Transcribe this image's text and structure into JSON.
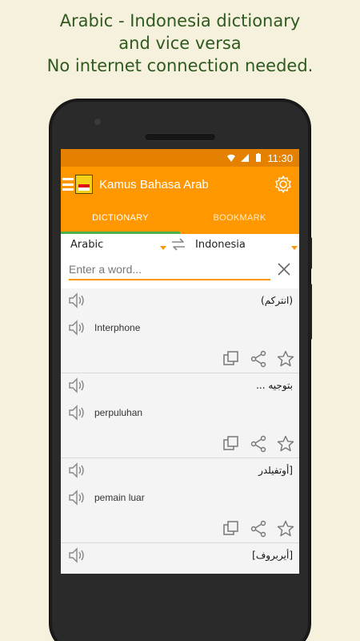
{
  "promo": {
    "line1": "Arabic - Indonesia dictionary",
    "line2": "and vice versa",
    "line3": "No internet connection needed."
  },
  "status": {
    "time": "11:30"
  },
  "app": {
    "title": "Kamus Bahasa Arab"
  },
  "tabs": [
    {
      "label": "DICTIONARY",
      "active": true
    },
    {
      "label": "BOOKMARK",
      "active": false
    }
  ],
  "languages": {
    "source": "Arabic",
    "target": "Indonesia"
  },
  "search": {
    "placeholder": "Enter a word..."
  },
  "results": [
    {
      "arabic": "(انتركم)",
      "translation": "Interphone"
    },
    {
      "arabic": "بتوجيه ...",
      "translation": "perpuluhan"
    },
    {
      "arabic": "[أوتفيلدر",
      "translation": "pemain luar"
    },
    {
      "arabic": "[أيربروف]",
      "translation": ""
    }
  ],
  "colors": {
    "accent": "#ff9800",
    "statusbar": "#e48100",
    "indicator": "#4caf50",
    "promo_text": "#2f5a1f"
  }
}
